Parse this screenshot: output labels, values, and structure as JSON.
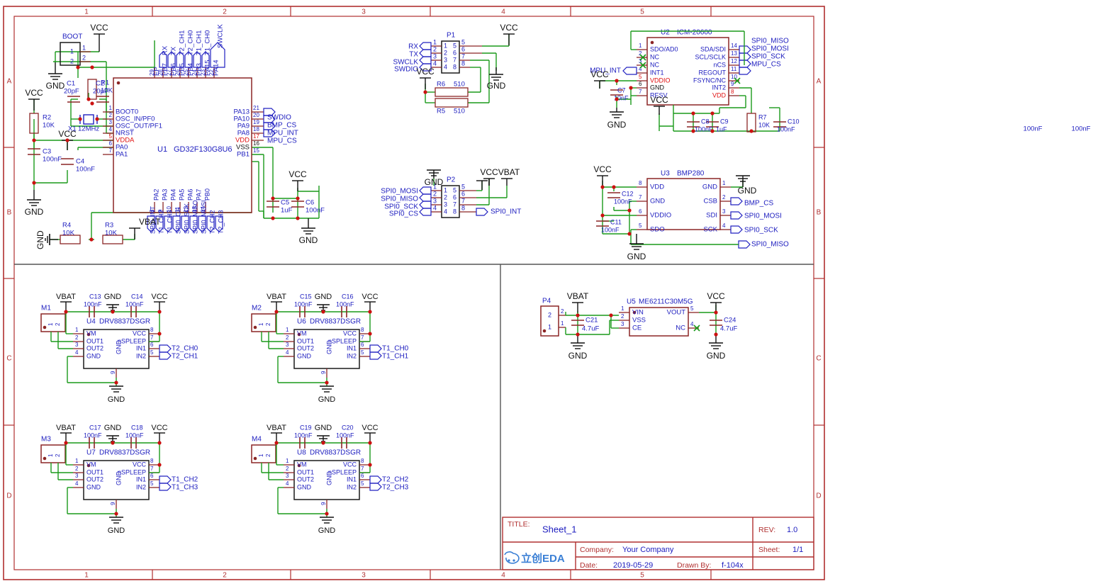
{
  "sheet": {
    "frame": {
      "zone_cols": [
        "1",
        "2",
        "3",
        "4",
        "5"
      ],
      "zone_rows": [
        "A",
        "B",
        "C",
        "D"
      ],
      "border_color": "#b03030"
    },
    "title_block": {
      "title_label": "TITLE:",
      "title_value": "Sheet_1",
      "rev_label": "REV:",
      "rev_value": "1.0",
      "company_label": "Company:",
      "company_value": "Your Company",
      "sheet_label": "Sheet:",
      "sheet_value": "1/1",
      "date_label": "Date:",
      "date_value": "2019-05-29",
      "drawn_label": "Drawn By:",
      "drawn_value": "f-104x",
      "logo_text": "立创EDA"
    }
  },
  "colors": {
    "wire": "#1a9a1a",
    "pin": "#8b2525",
    "symbol": "#8b2525",
    "net_label": "#2020c0",
    "power_text": "#101010",
    "red_pin": "#e01010",
    "junction": "#cc1111",
    "connector_blue": "#2020c0"
  },
  "components": {
    "u1": {
      "ref": "U1",
      "name": "GD32F130G8U6",
      "pins_top": [
        {
          "num": "29",
          "name": "EP"
        },
        {
          "num": "28",
          "name": "PB7"
        },
        {
          "num": "27",
          "name": "PB6"
        },
        {
          "num": "26",
          "name": "PB5"
        },
        {
          "num": "25",
          "name": "PB4"
        },
        {
          "num": "24",
          "name": "PB3"
        },
        {
          "num": "23",
          "name": "PA15"
        },
        {
          "num": "22",
          "name": "PA14"
        }
      ],
      "nets_top": [
        "RX",
        "TX",
        "T2_CH1",
        "T2_CH0",
        "T1_CH1",
        "T1_CH0",
        "SWCLK"
      ],
      "pins_left": [
        {
          "num": "1",
          "name": "BOOT0"
        },
        {
          "num": "2",
          "name": "OSC_IN/PF0"
        },
        {
          "num": "3",
          "name": "OSC_OUT/PF1"
        },
        {
          "num": "4",
          "name": "NRST"
        },
        {
          "num": "5",
          "name": "VDDA",
          "power": true
        },
        {
          "num": "6",
          "name": "PA0"
        },
        {
          "num": "7",
          "name": "PA1"
        }
      ],
      "pins_right": [
        {
          "num": "21",
          "name": "PA13"
        },
        {
          "num": "20",
          "name": "PA10"
        },
        {
          "num": "19",
          "name": "PA9"
        },
        {
          "num": "18",
          "name": "PA8"
        },
        {
          "num": "17",
          "name": "VDD",
          "power": true
        },
        {
          "num": "16",
          "name": "VSS",
          "gnd": true
        },
        {
          "num": "15",
          "name": "PB1"
        }
      ],
      "nets_right": [
        "SWDIO",
        "BMP_CS",
        "MPU_INT",
        "MPU_CS"
      ],
      "pins_bottom": [
        {
          "num": "8",
          "name": "PA2"
        },
        {
          "num": "9",
          "name": "PA3"
        },
        {
          "num": "10",
          "name": "PA4"
        },
        {
          "num": "11",
          "name": "PA5"
        },
        {
          "num": "12",
          "name": "PA6"
        },
        {
          "num": "13",
          "name": "PA7"
        },
        {
          "num": "14",
          "name": "PB0"
        }
      ],
      "nets_bottom": [
        "SPI0_INT",
        "T1_CH2",
        "T1_CH3",
        "SPI0_CS",
        "SPI0_SCK",
        "SPI0_MISO",
        "SPI0_MOSI",
        "T2_CH2",
        "T2_CH3"
      ]
    },
    "u2": {
      "ref": "U2",
      "name": "ICM-20600",
      "pins_left": [
        {
          "num": "1",
          "name": "SDO/AD0"
        },
        {
          "num": "2",
          "name": "NC",
          "nc": true
        },
        {
          "num": "3",
          "name": "NC",
          "nc": true
        },
        {
          "num": "4",
          "name": "INT1"
        },
        {
          "num": "5",
          "name": "VDDIO",
          "power": true
        },
        {
          "num": "6",
          "name": "GND",
          "gnd": true
        },
        {
          "num": "7",
          "name": "RESV"
        }
      ],
      "pins_right": [
        {
          "num": "14",
          "name": "SDA/SDI"
        },
        {
          "num": "13",
          "name": "SCL/SCLK"
        },
        {
          "num": "12",
          "name": "nCS"
        },
        {
          "num": "11",
          "name": "REGOUT"
        },
        {
          "num": "10",
          "name": "FSYNC/NC",
          "nc": true
        },
        {
          "num": "9",
          "name": "INT2"
        },
        {
          "num": "8",
          "name": "VDD",
          "power": true
        }
      ],
      "nets_right": [
        "SPI0_MISO",
        "SPI0_MOSI",
        "SPI0_SCK",
        "MPU_CS"
      ],
      "net_left": "MPU_INT"
    },
    "u3": {
      "ref": "U3",
      "name": "BMP280",
      "pins_left": [
        {
          "num": "8",
          "name": "VDD"
        },
        {
          "num": "7",
          "name": "GND"
        },
        {
          "num": "6",
          "name": "VDDIO"
        },
        {
          "num": "5",
          "name": "SDO"
        }
      ],
      "pins_right": [
        {
          "num": "1",
          "name": "GND"
        },
        {
          "num": "2",
          "name": "CSB"
        },
        {
          "num": "3",
          "name": "SDI"
        },
        {
          "num": "4",
          "name": "SCK"
        }
      ],
      "nets_right": [
        "BMP_CS",
        "SPI0_MOSI",
        "SPI0_SCK",
        "SPI0_MISO"
      ]
    },
    "u5": {
      "ref": "U5",
      "name": "ME6211C30M5G",
      "pins_left": [
        {
          "num": "1",
          "name": "VIN"
        },
        {
          "num": "2",
          "name": "VSS"
        },
        {
          "num": "3",
          "name": "CE"
        }
      ],
      "pins_right": [
        {
          "num": "5",
          "name": "VOUT"
        },
        {
          "num": "4",
          "name": "NC",
          "nc": true
        }
      ]
    },
    "drivers": [
      {
        "ref": "U4",
        "name": "DRV8837DSGR",
        "motor": "M1",
        "cap_left": "C13",
        "cap_left_val": "100nF",
        "cap_right": "C14",
        "cap_right_val": "100nF",
        "nets": [
          "T2_CH0",
          "T2_CH1"
        ]
      },
      {
        "ref": "U6",
        "name": "DRV8837DSGR",
        "motor": "M2",
        "cap_left": "C15",
        "cap_left_val": "100nF",
        "cap_right": "C16",
        "cap_right_val": "100nF",
        "nets": [
          "T1_CH0",
          "T1_CH1"
        ]
      },
      {
        "ref": "U7",
        "name": "DRV8837DSGR",
        "motor": "M3",
        "cap_left": "C17",
        "cap_left_val": "100nF",
        "cap_right": "C18",
        "cap_right_val": "100nF",
        "nets": [
          "T1_CH2",
          "T1_CH3"
        ]
      },
      {
        "ref": "U8",
        "name": "DRV8837DSGR",
        "motor": "M4",
        "cap_left": "C19",
        "cap_left_val": "100nF",
        "cap_right": "C20",
        "cap_right_val": "100nF",
        "nets": [
          "T2_CH2",
          "T2_CH3"
        ]
      }
    ],
    "driver_pins_left": [
      {
        "num": "1",
        "name": "VM"
      },
      {
        "num": "2",
        "name": "OUT1"
      },
      {
        "num": "3",
        "name": "OUT2"
      },
      {
        "num": "4",
        "name": "GND"
      }
    ],
    "driver_pins_right": [
      {
        "num": "8",
        "name": "VCC"
      },
      {
        "num": "7",
        "name": "nSPLEEP"
      },
      {
        "num": "6",
        "name": "IN1"
      },
      {
        "num": "5",
        "name": "IN2"
      }
    ],
    "driver_pin_bottom": {
      "num": "9",
      "name": "GND"
    },
    "p1": {
      "ref": "P1",
      "left_pins": [
        "1",
        "2",
        "3",
        "4"
      ],
      "right_pins": [
        "5",
        "6",
        "7",
        "8"
      ],
      "nets": [
        "RX",
        "TX",
        "SWCLK",
        "SWDIO"
      ]
    },
    "p2": {
      "ref": "P2",
      "left_pins": [
        "1",
        "2",
        "3",
        "4"
      ],
      "right_pins": [
        "5",
        "6",
        "7",
        "8"
      ],
      "nets": [
        "SPI0_MOSI",
        "SPI0_MISO",
        "SPI0_SCK",
        "SPI0_CS"
      ],
      "net_right": "SPI0_INT"
    },
    "p4": {
      "ref": "P4",
      "pins": [
        "2",
        "1"
      ]
    },
    "boot": {
      "ref": "BOOT",
      "pins": [
        "1",
        "2"
      ]
    },
    "resistors": [
      {
        "ref": "R1",
        "value": "10K"
      },
      {
        "ref": "R2",
        "value": "10K"
      },
      {
        "ref": "R3",
        "value": "10K"
      },
      {
        "ref": "R4",
        "value": "10K"
      },
      {
        "ref": "R5",
        "value": "510"
      },
      {
        "ref": "R6",
        "value": "510"
      },
      {
        "ref": "R7",
        "value": "10K"
      }
    ],
    "capacitors": [
      {
        "ref": "C1",
        "value": "20pF"
      },
      {
        "ref": "C2",
        "value": "20pF"
      },
      {
        "ref": "C3",
        "value": "100nF"
      },
      {
        "ref": "C4",
        "value": "100nF"
      },
      {
        "ref": "C5",
        "value": "1uF"
      },
      {
        "ref": "C6",
        "value": "100nF"
      },
      {
        "ref": "C7",
        "value": "10nF"
      },
      {
        "ref": "C8",
        "value": "100nF"
      },
      {
        "ref": "C9",
        "value": "1uF"
      },
      {
        "ref": "C10",
        "value": "100nF"
      },
      {
        "ref": "C11",
        "value": "100nF"
      },
      {
        "ref": "C12",
        "value": "100nF"
      },
      {
        "ref": "C21",
        "value": "4.7uF"
      },
      {
        "ref": "C24",
        "value": "4.7uF"
      }
    ],
    "crystal": {
      "ref": "X1",
      "value": "12MHz"
    },
    "stray_labels": [
      "100nF",
      "100nF"
    ]
  },
  "power_symbols": {
    "vcc": "VCC",
    "gnd": "GND",
    "vbat": "VBAT"
  }
}
